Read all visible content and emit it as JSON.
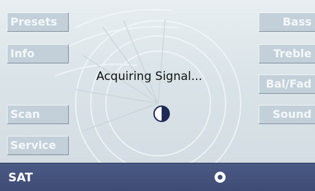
{
  "left_buttons": [
    "Presets",
    "Info",
    "Scan",
    "Service"
  ],
  "right_buttons": [
    "Bass",
    "Treble",
    "Bal/Fad",
    "Sound"
  ],
  "status_message": "Acquiring Signal...",
  "source_label": "SAT",
  "colors": {
    "button_face": "#c3d0d9",
    "button_text": "#f4f8fb",
    "bottom_bar": "#3d4b75"
  },
  "icons": {
    "loading": "half-circle-icon",
    "indicator": "radio-dot-icon"
  }
}
